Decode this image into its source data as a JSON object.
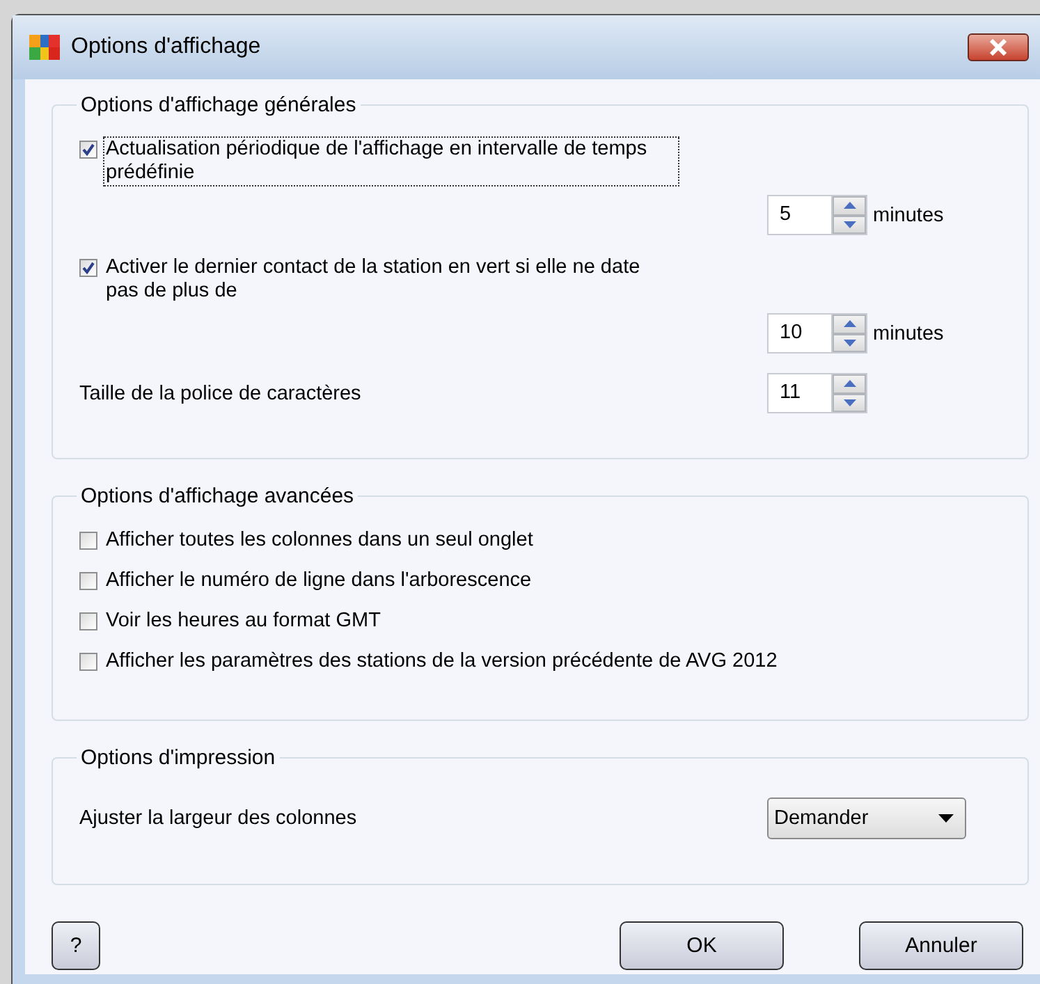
{
  "window": {
    "title": "Options d'affichage"
  },
  "groups": [
    {
      "title": "Options d'affichage générales",
      "items": [
        {
          "kind": "checkbox",
          "label": "Actualisation périodique de l'affichage en intervalle de temps prédéfinie",
          "checked": true,
          "focused": true
        },
        {
          "kind": "spinner",
          "value": "5",
          "unit": "minutes"
        },
        {
          "kind": "checkbox",
          "label": "Activer le dernier contact de la station en vert si elle ne date pas de plus de",
          "checked": true,
          "focused": false
        },
        {
          "kind": "spinner",
          "value": "10",
          "unit": "minutes"
        },
        {
          "kind": "spinner",
          "label": "Taille de la police de caractères",
          "value": "11"
        }
      ]
    },
    {
      "title": "Options d'affichage avancées",
      "items": [
        {
          "kind": "checkbox",
          "label": "Afficher toutes les colonnes dans un seul onglet",
          "checked": false,
          "focused": false
        },
        {
          "kind": "checkbox",
          "label": "Afficher le numéro de ligne dans l'arborescence",
          "checked": false,
          "focused": false
        },
        {
          "kind": "checkbox",
          "label": "Voir les heures au format GMT",
          "checked": false,
          "focused": false
        },
        {
          "kind": "checkbox",
          "label": "Afficher les paramètres des stations de la version précédente de AVG 2012",
          "checked": false,
          "focused": false
        }
      ]
    },
    {
      "title": "Options d'impression",
      "items": [
        {
          "kind": "dropdown",
          "label": "Ajuster la largeur des colonnes",
          "value": "Demander"
        }
      ]
    }
  ],
  "buttons": [
    {
      "kind": "help",
      "label": "?"
    },
    {
      "kind": "ok",
      "label": "OK"
    },
    {
      "kind": "cancel",
      "label": "Annuler"
    }
  ]
}
